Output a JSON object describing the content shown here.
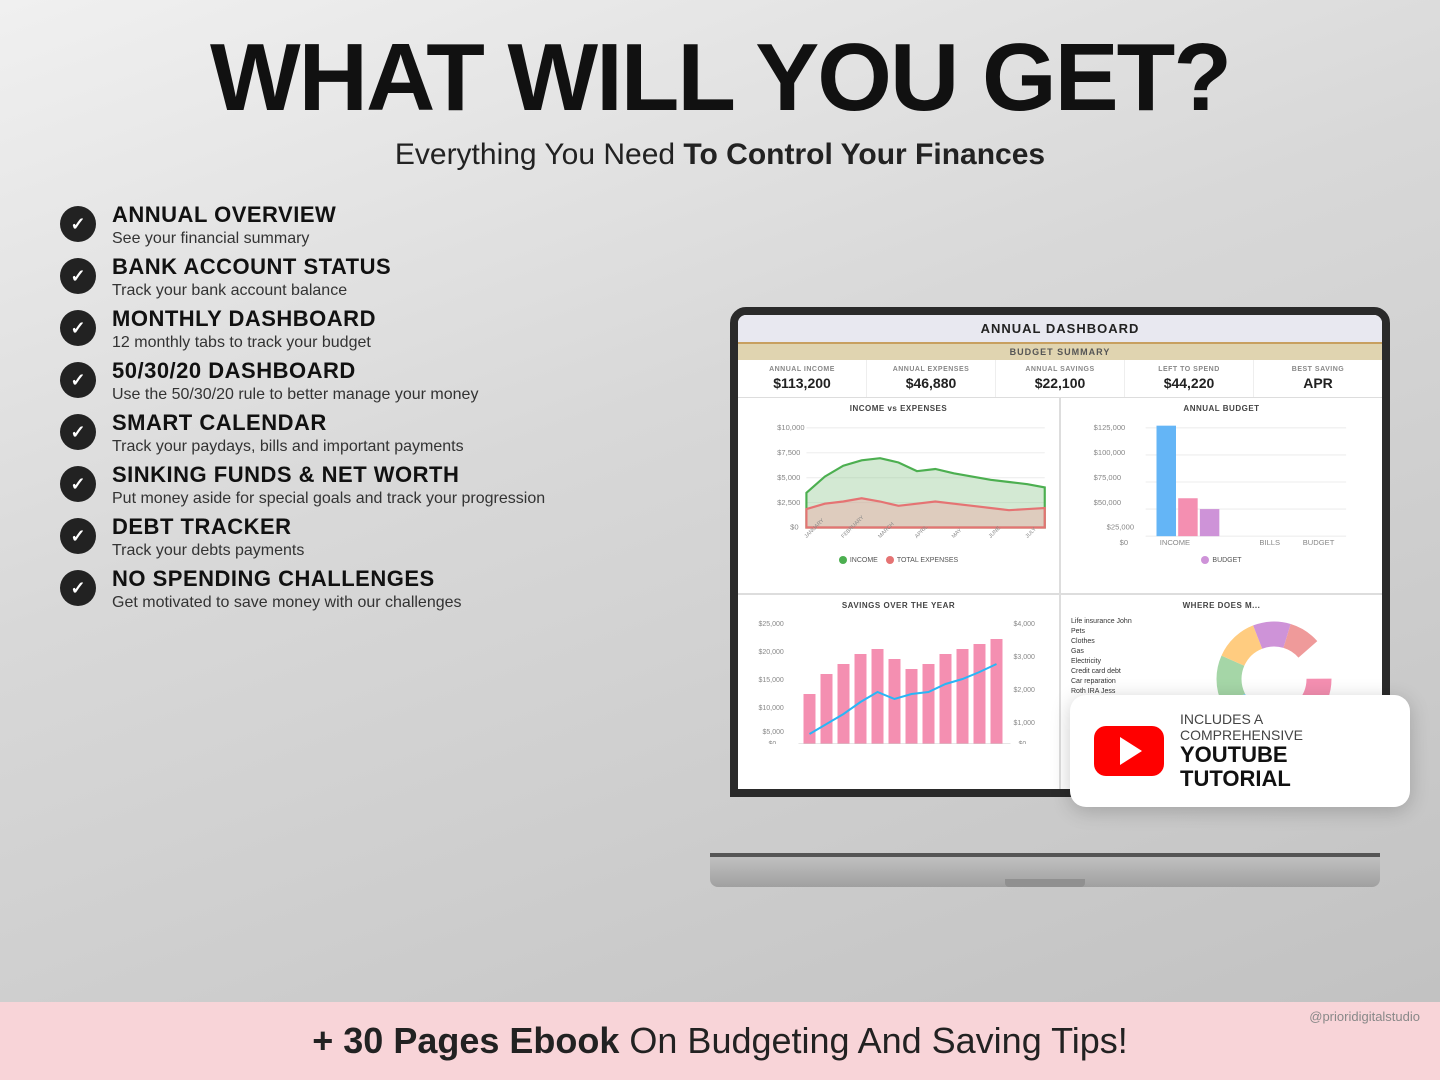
{
  "page": {
    "title": "WHAT WILL YOU GET?",
    "subtitle_normal": "Everything You Need ",
    "subtitle_bold": "To Control Your Finances"
  },
  "features": [
    {
      "id": "annual-overview",
      "title": "ANNUAL OVERVIEW",
      "description": "See your financial summary"
    },
    {
      "id": "bank-account",
      "title": "BANK ACCOUNT STATUS",
      "description": "Track your bank account balance"
    },
    {
      "id": "monthly-dashboard",
      "title": "MONTHLY DASHBOARD",
      "description": "12 monthly tabs to track your budget"
    },
    {
      "id": "503020",
      "title": "50/30/20 DASHBOARD",
      "description": "Use the 50/30/20 rule to better manage your money"
    },
    {
      "id": "smart-calendar",
      "title": "SMART CALENDAR",
      "description": "Track your paydays, bills and important payments"
    },
    {
      "id": "sinking-funds",
      "title": "SINKING FUNDS & NET WORTH",
      "description": "Put money aside for special goals and track your progression"
    },
    {
      "id": "debt-tracker",
      "title": "DEBT TRACKER",
      "description": "Track your debts payments"
    },
    {
      "id": "no-spending",
      "title": "NO SPENDING CHALLENGES",
      "description": "Get motivated to save money with our challenges"
    }
  ],
  "dashboard": {
    "title": "ANNUAL DASHBOARD",
    "budget_summary_label": "BUDGET SUMMARY",
    "stats": [
      {
        "label": "ANNUAL INCOME",
        "value": "$113,200"
      },
      {
        "label": "ANNUAL EXPENSES",
        "value": "$46,880"
      },
      {
        "label": "ANNUAL SAVINGS",
        "value": "$22,100"
      },
      {
        "label": "LEFT TO SPEND",
        "value": "$44,220"
      },
      {
        "label": "BEST SAVING",
        "value": "APR"
      }
    ],
    "chart1_title": "INCOME vs EXPENSES",
    "chart2_title": "ANNUAL BUDGET",
    "chart3_title": "SAVINGS OVER THE YEAR",
    "chart4_title": "WHERE DOES M..."
  },
  "youtube": {
    "includes": "INCLUDES A COMPREHENSIVE",
    "tutorial": "YOUTUBE TUTORIAL"
  },
  "bottom_banner": {
    "bold_part": "+ 30 Pages Ebook",
    "normal_part": " On Budgeting And Saving Tips!"
  },
  "watermark": "@prioridigitalstudio",
  "colors": {
    "background_start": "#f0f0f0",
    "background_end": "#b0b0b0",
    "title": "#111111",
    "accent_orange": "#c8a060",
    "check_bg": "#222222",
    "bottom_banner_bg": "#f8d4d8",
    "youtube_red": "#FF0000"
  }
}
